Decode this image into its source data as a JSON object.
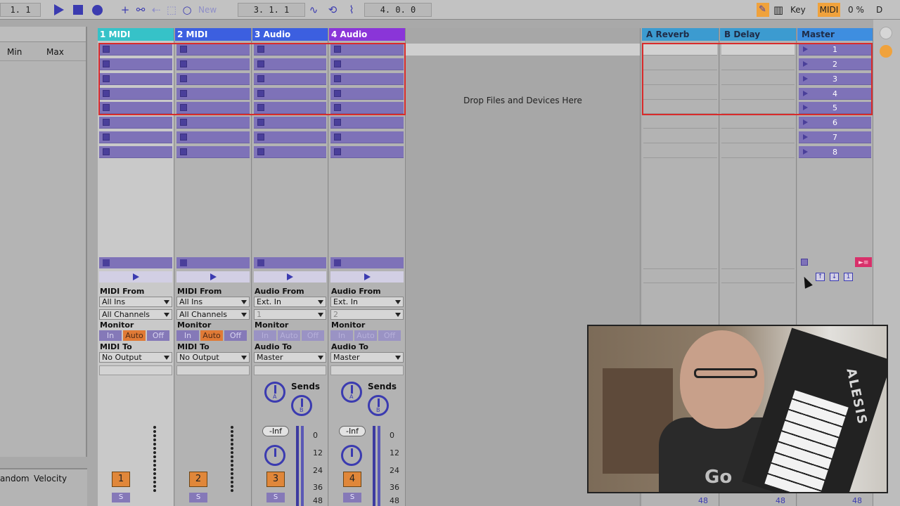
{
  "transport": {
    "bar_position": "1.  1",
    "new_label": "New",
    "arrangement_position": "3.   1.   1",
    "loop_length": "4.   0.   0",
    "key_label": "Key",
    "midi_label": "MIDI",
    "cpu_load": "0 %",
    "d_label": "D"
  },
  "browser": {
    "col_min": "Min",
    "col_max": "Max",
    "bottom_random": "andom",
    "bottom_velocity": "Velocity"
  },
  "tracks": [
    {
      "name": "1 MIDI",
      "color": "#36c2c8",
      "input_title": "MIDI From",
      "input_source": "All Ins",
      "input_channel": "All Channels",
      "monitor_title": "Monitor",
      "mon_in": "In",
      "mon_auto": "Auto",
      "mon_off": "Off",
      "output_title": "MIDI To",
      "output_target": "No Output",
      "number": "1",
      "solo": "S"
    },
    {
      "name": "2 MIDI",
      "color": "#3c5fe0",
      "input_title": "MIDI From",
      "input_source": "All Ins",
      "input_channel": "All Channels",
      "monitor_title": "Monitor",
      "mon_in": "In",
      "mon_auto": "Auto",
      "mon_off": "Off",
      "output_title": "MIDI To",
      "output_target": "No Output",
      "number": "2",
      "solo": "S"
    },
    {
      "name": "3 Audio",
      "color": "#3c5fe0",
      "input_title": "Audio From",
      "input_source": "Ext. In",
      "input_channel": "1",
      "monitor_title": "Monitor",
      "mon_in": "In",
      "mon_auto": "Auto",
      "mon_off": "Off",
      "output_title": "Audio To",
      "output_target": "Master",
      "number": "3",
      "solo": "S",
      "volume": "-Inf"
    },
    {
      "name": "4 Audio",
      "color": "#8a35d8",
      "input_title": "Audio From",
      "input_source": "Ext. In",
      "input_channel": "2",
      "monitor_title": "Monitor",
      "mon_in": "In",
      "mon_auto": "Auto",
      "mon_off": "Off",
      "output_title": "Audio To",
      "output_target": "Master",
      "number": "4",
      "solo": "S",
      "volume": "-Inf"
    }
  ],
  "sends_label": "Sends",
  "knob_a": "A",
  "knob_b": "B",
  "meter_ticks": [
    "0",
    "12",
    "24",
    "36",
    "48"
  ],
  "drop_area_text": "Drop Files and Devices Here",
  "returns": [
    {
      "name": "A Reverb"
    },
    {
      "name": "B Delay"
    }
  ],
  "master": {
    "name": "Master",
    "scenes": [
      "1",
      "2",
      "3",
      "4",
      "5",
      "6",
      "7",
      "8"
    ],
    "mini_value": "1"
  },
  "webcam": {
    "keyboard_brand": "ALESIS",
    "shirt_text": "Go"
  },
  "bottom_bg_ticks": [
    "48",
    "48",
    "48"
  ]
}
